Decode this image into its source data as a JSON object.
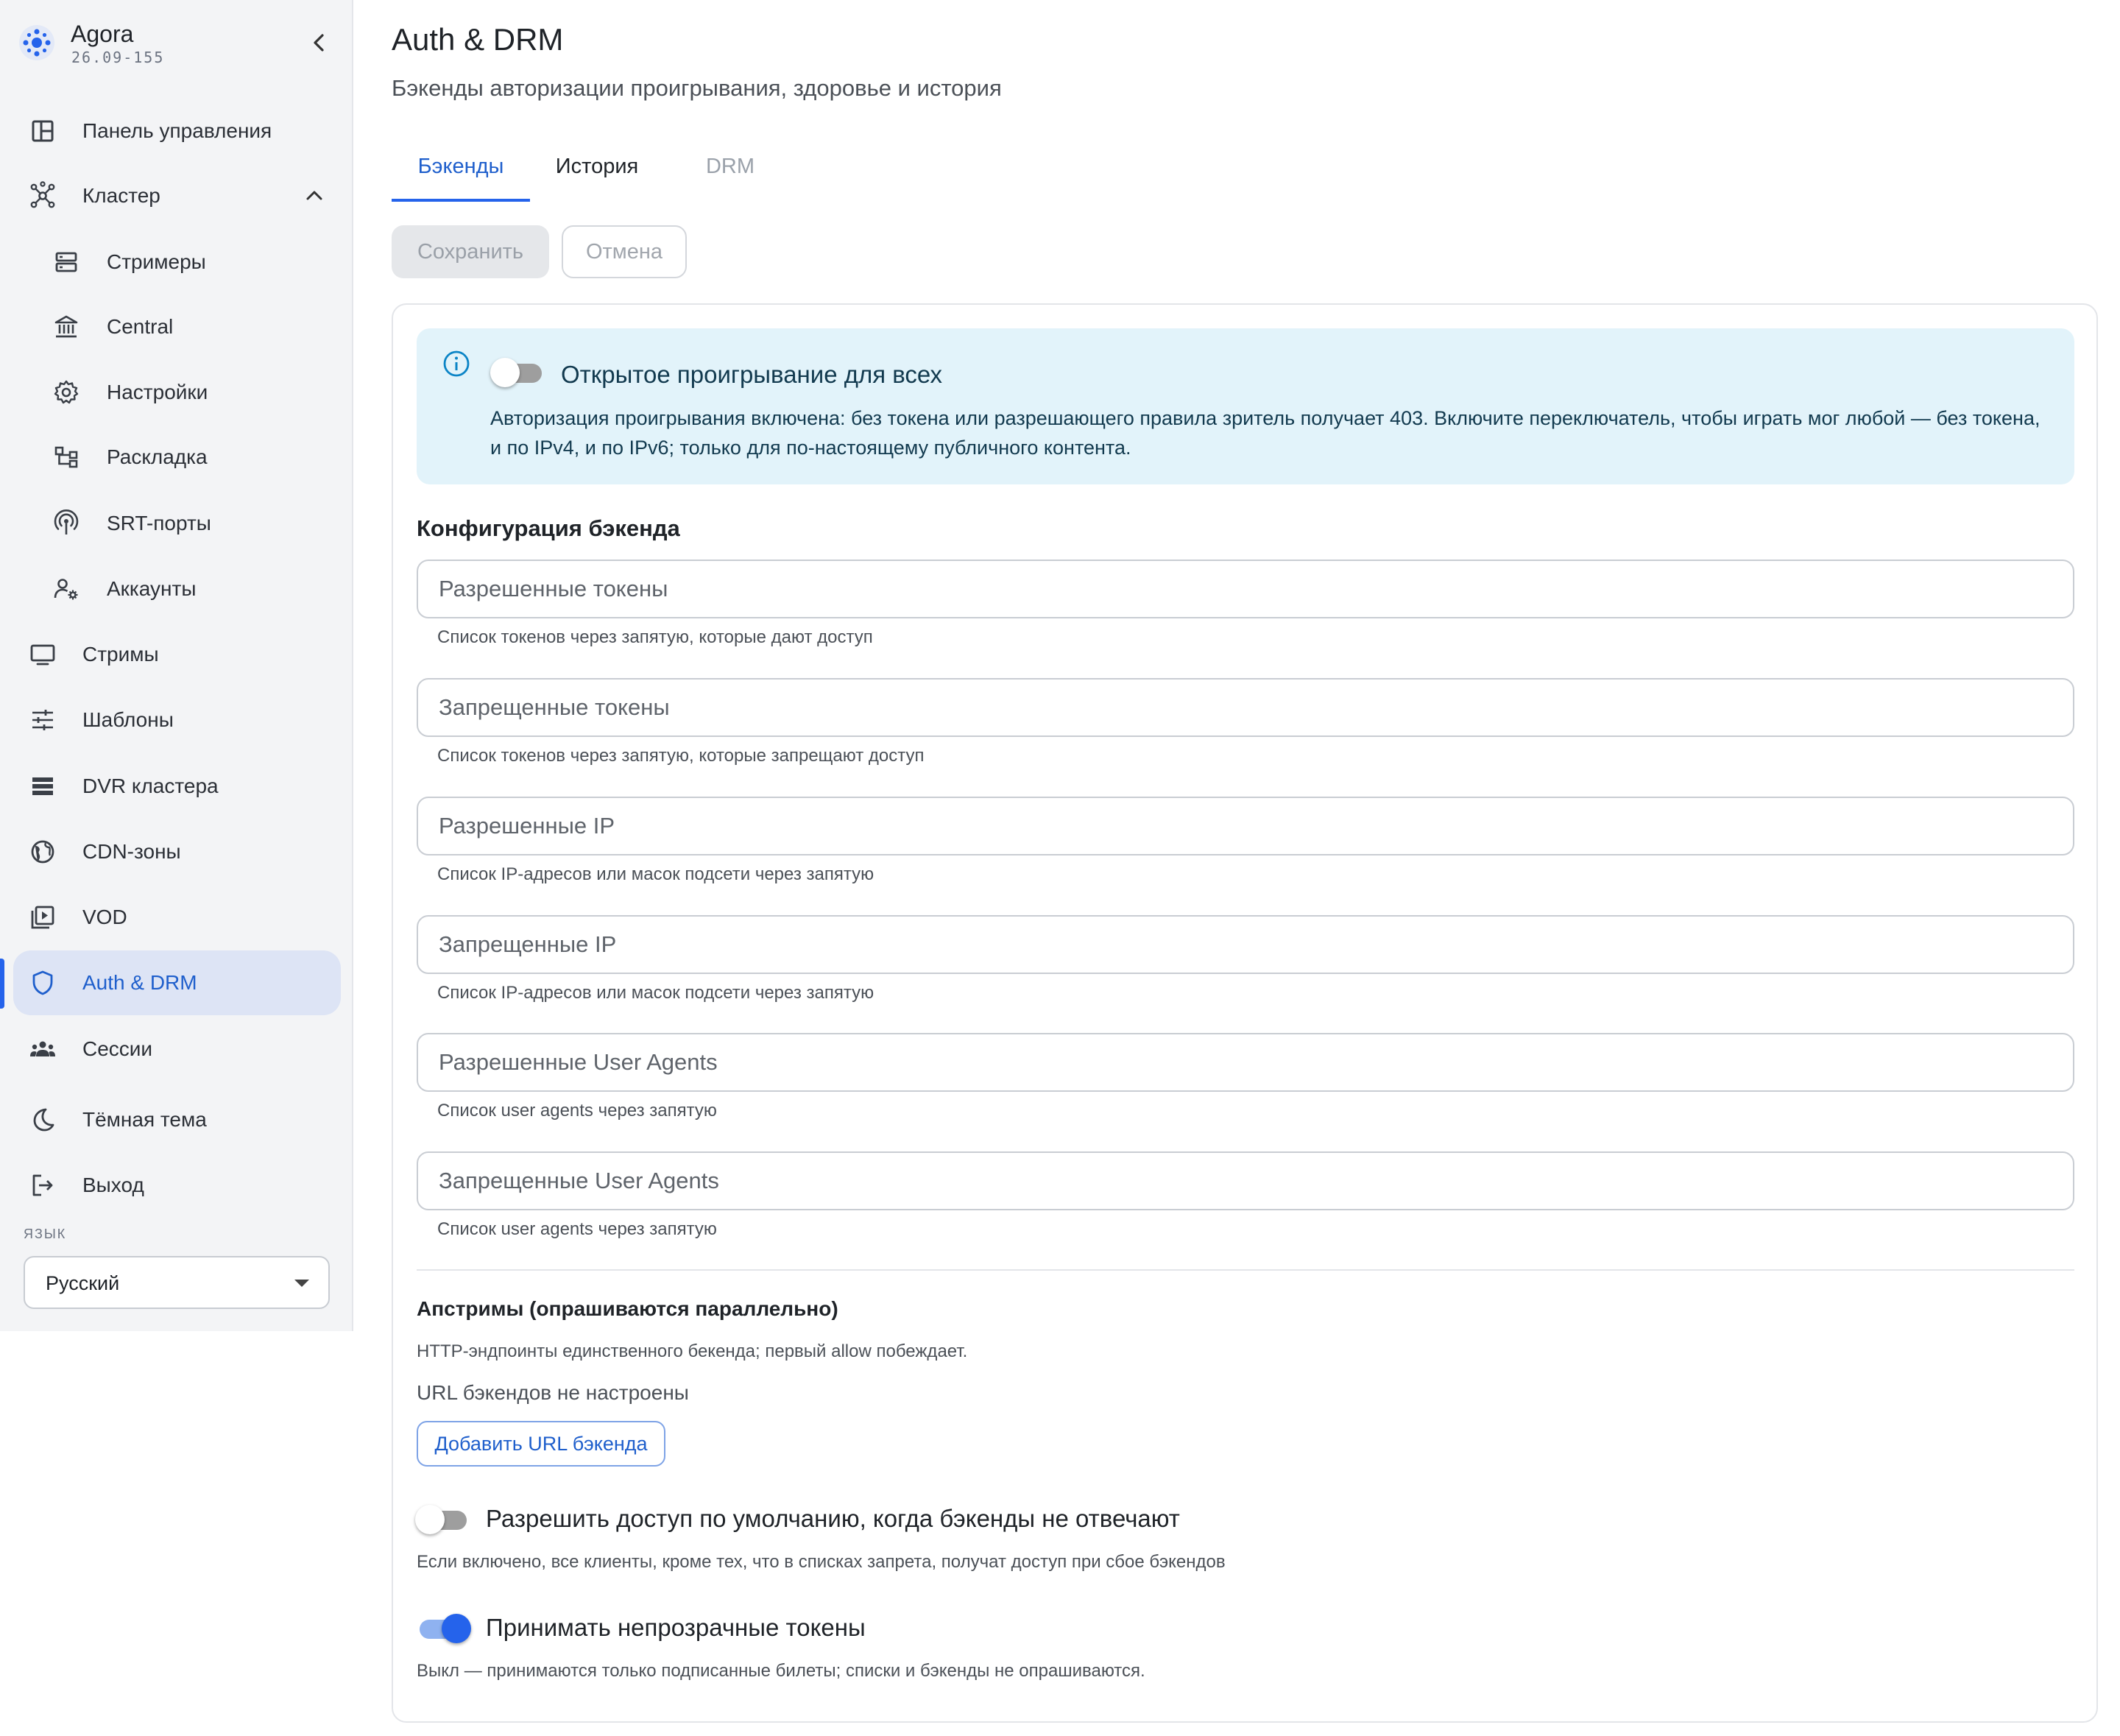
{
  "app": {
    "name": "Agora",
    "version": "26.09-155"
  },
  "sidebar": {
    "items": [
      {
        "label": "Панель управления",
        "icon": "dashboard-icon"
      },
      {
        "label": "Кластер",
        "icon": "cluster-icon",
        "expanded": true
      },
      {
        "label": "Стримеры",
        "icon": "server-icon"
      },
      {
        "label": "Central",
        "icon": "bank-icon"
      },
      {
        "label": "Настройки",
        "icon": "gear-icon"
      },
      {
        "label": "Раскладка",
        "icon": "layout-tree-icon"
      },
      {
        "label": "SRT-порты",
        "icon": "broadcast-icon"
      },
      {
        "label": "Аккаунты",
        "icon": "accounts-icon"
      },
      {
        "label": "Стримы",
        "icon": "monitor-icon"
      },
      {
        "label": "Шаблоны",
        "icon": "sliders-icon"
      },
      {
        "label": "DVR кластера",
        "icon": "storage-icon"
      },
      {
        "label": "CDN-зоны",
        "icon": "globe-icon"
      },
      {
        "label": "VOD",
        "icon": "video-library-icon"
      },
      {
        "label": "Auth & DRM",
        "icon": "shield-icon",
        "active": true
      },
      {
        "label": "Сессии",
        "icon": "users-icon"
      },
      {
        "label": "Тёмная тема",
        "icon": "moon-icon"
      },
      {
        "label": "Выход",
        "icon": "logout-icon"
      }
    ],
    "language_caption": "ЯЗЫК",
    "language_value": "Русский"
  },
  "page": {
    "title": "Auth & DRM",
    "subtitle": "Бэкенды авторизации проигрывания, здоровье и история"
  },
  "tabs": [
    {
      "label": "Бэкенды",
      "active": true
    },
    {
      "label": "История",
      "active": false
    },
    {
      "label": "DRM",
      "active": false,
      "disabled": true
    }
  ],
  "actions": {
    "save": "Сохранить",
    "cancel": "Отмена"
  },
  "info": {
    "toggle_label": "Открытое проигрывание для всех",
    "toggle_on": false,
    "text": "Авторизация проигрывания включена: без токена или разрешающего правила зритель получает 403. Включите переключатель, чтобы играть мог любой — без токена, и по IPv4, и по IPv6; только для по-настоящему публичного контента."
  },
  "config": {
    "title": "Конфигурация бэкенда",
    "fields": [
      {
        "placeholder": "Разрешенные токены",
        "value": "",
        "helper": "Список токенов через запятую, которые дают доступ"
      },
      {
        "placeholder": "Запрещенные токены",
        "value": "",
        "helper": "Список токенов через запятую, которые запрещают доступ"
      },
      {
        "placeholder": "Разрешенные IP",
        "value": "",
        "helper": "Список IP-адресов или масок подсети через запятую"
      },
      {
        "placeholder": "Запрещенные IP",
        "value": "",
        "helper": "Список IP-адресов или масок подсети через запятую"
      },
      {
        "placeholder": "Разрешенные User Agents",
        "value": "",
        "helper": "Список user agents через запятую"
      },
      {
        "placeholder": "Запрещенные User Agents",
        "value": "",
        "helper": "Список user agents через запятую"
      }
    ]
  },
  "upstreams": {
    "title": "Апстримы (опрашиваются параллельно)",
    "description": "HTTP-эндпоинты единственного бекенда; первый allow побеждает.",
    "empty_text": "URL бэкендов не настроены",
    "add_button": "Добавить URL бэкенда"
  },
  "options": [
    {
      "label": "Разрешить доступ по умолчанию, когда бэкенды не отвечают",
      "on": false,
      "help": "Если включено, все клиенты, кроме тех, что в списках запрета, получат доступ при сбое бэкендов"
    },
    {
      "label": "Принимать непрозрачные токены",
      "on": true,
      "help": "Выкл — принимаются только подписанные билеты; списки и бэкенды не опрашиваются."
    }
  ],
  "colors": {
    "accent": "#2563eb",
    "active_bg": "#dde4f5",
    "info_bg": "#e2f3fa"
  }
}
